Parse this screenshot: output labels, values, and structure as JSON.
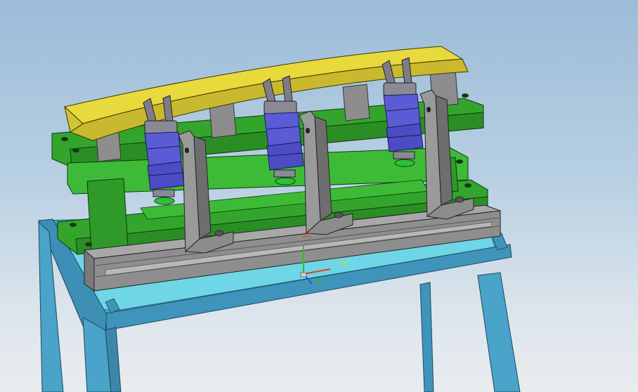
{
  "viewport": {
    "background_top": "#9cbcd8",
    "background_bottom": "#e8ecef"
  },
  "colors": {
    "frame": "#4aa3c8",
    "frame_light": "#6ed6e6",
    "base": "#2f8f2a",
    "base_light": "#3dbb36",
    "rail": "#8e8e8e",
    "bracket": "#8c8c8c",
    "fixture_part": "#e2d33a",
    "gripper": "#5b5bd6",
    "gripper_gray": "#8a8a95",
    "gripper_tip": "#2fbf3a"
  },
  "triad": {
    "x_label": "XC",
    "y_label": "YC",
    "z_label": "ZC",
    "x_color": "#d8d830",
    "y_color": "#e04020",
    "z_color": "#30c020"
  }
}
